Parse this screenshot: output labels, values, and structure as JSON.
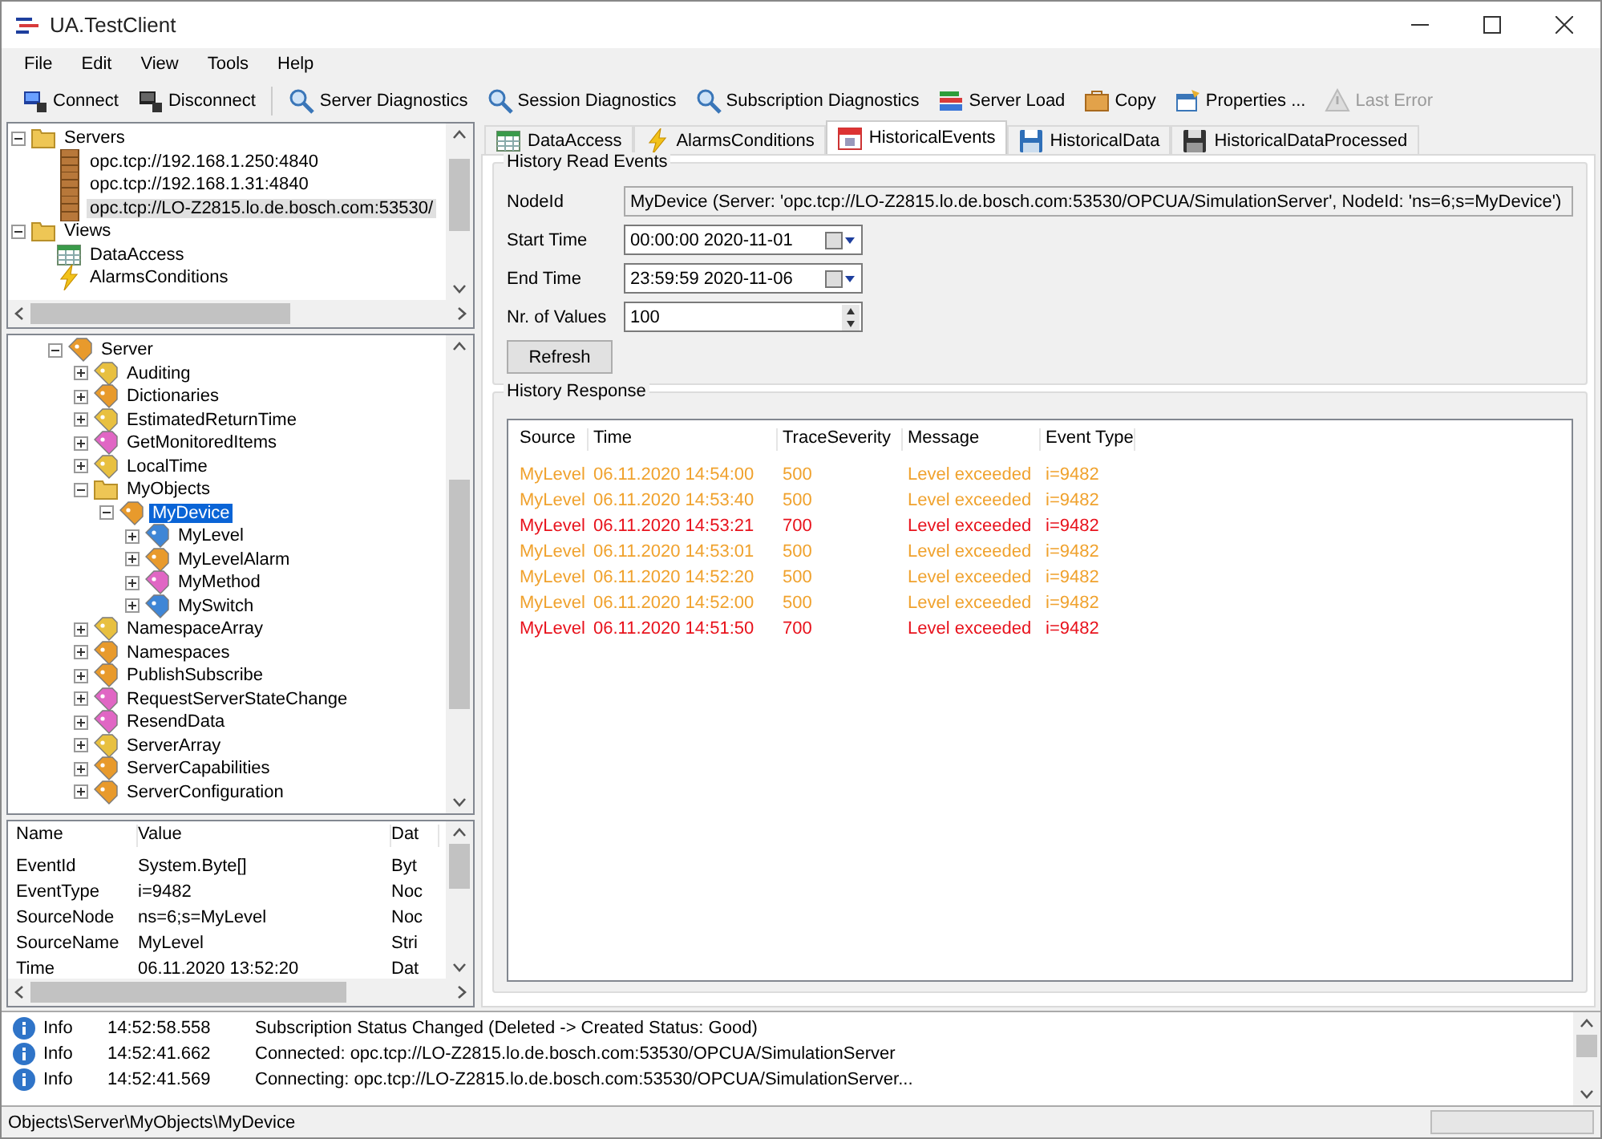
{
  "window": {
    "title": "UA.TestClient"
  },
  "menu": [
    "File",
    "Edit",
    "View",
    "Tools",
    "Help"
  ],
  "toolbar": [
    {
      "label": "Connect",
      "kind": "connect",
      "disabled": false
    },
    {
      "label": "Disconnect",
      "kind": "disconnect",
      "disabled": false,
      "separator_after": true
    },
    {
      "label": "Server Diagnostics",
      "kind": "search",
      "disabled": false
    },
    {
      "label": "Session Diagnostics",
      "kind": "search",
      "disabled": false
    },
    {
      "label": "Subscription Diagnostics",
      "kind": "search",
      "disabled": false
    },
    {
      "label": "Server Load",
      "kind": "load",
      "disabled": false
    },
    {
      "label": "Copy",
      "kind": "copy",
      "disabled": false
    },
    {
      "label": "Properties ...",
      "kind": "properties",
      "disabled": false
    },
    {
      "label": "Last Error",
      "kind": "warning",
      "disabled": true
    }
  ],
  "server_tree": [
    {
      "label": "Servers",
      "kind": "folder",
      "expanded": true,
      "selected": false,
      "children": [
        {
          "label": "opc.tcp://192.168.1.250:4840",
          "kind": "server",
          "selected": false
        },
        {
          "label": "opc.tcp://192.168.1.31:4840",
          "kind": "server",
          "selected": false
        },
        {
          "label": "opc.tcp://LO-Z2815.lo.de.bosch.com:53530/",
          "kind": "server",
          "selected": true
        }
      ]
    },
    {
      "label": "Views",
      "kind": "folder",
      "expanded": true,
      "selected": false,
      "children": [
        {
          "label": "DataAccess",
          "kind": "grid",
          "selected": false
        },
        {
          "label": "AlarmsConditions",
          "kind": "lightning",
          "selected": false
        }
      ]
    }
  ],
  "node_tree": [
    {
      "label": "Server",
      "kind": "object",
      "expanded": true,
      "selected": false,
      "children": [
        {
          "label": "Auditing",
          "kind": "property",
          "expanded": false,
          "selected": false
        },
        {
          "label": "Dictionaries",
          "kind": "object",
          "expanded": false,
          "selected": false
        },
        {
          "label": "EstimatedReturnTime",
          "kind": "property",
          "expanded": false,
          "selected": false
        },
        {
          "label": "GetMonitoredItems",
          "kind": "method",
          "expanded": false,
          "selected": false
        },
        {
          "label": "LocalTime",
          "kind": "property",
          "expanded": false,
          "selected": false
        },
        {
          "label": "MyObjects",
          "kind": "folder",
          "expanded": true,
          "selected": false,
          "children": [
            {
              "label": "MyDevice",
              "kind": "object",
              "expanded": true,
              "selected": true,
              "children": [
                {
                  "label": "MyLevel",
                  "kind": "variable",
                  "expanded": false,
                  "selected": false
                },
                {
                  "label": "MyLevelAlarm",
                  "kind": "object",
                  "expanded": false,
                  "selected": false
                },
                {
                  "label": "MyMethod",
                  "kind": "method",
                  "expanded": false,
                  "selected": false
                },
                {
                  "label": "MySwitch",
                  "kind": "variable",
                  "expanded": false,
                  "selected": false
                }
              ]
            }
          ]
        },
        {
          "label": "NamespaceArray",
          "kind": "property",
          "expanded": false,
          "selected": false
        },
        {
          "label": "Namespaces",
          "kind": "object",
          "expanded": false,
          "selected": false
        },
        {
          "label": "PublishSubscribe",
          "kind": "object",
          "expanded": false,
          "selected": false
        },
        {
          "label": "RequestServerStateChange",
          "kind": "method",
          "expanded": false,
          "selected": false
        },
        {
          "label": "ResendData",
          "kind": "method",
          "expanded": false,
          "selected": false
        },
        {
          "label": "ServerArray",
          "kind": "property",
          "expanded": false,
          "selected": false
        },
        {
          "label": "ServerCapabilities",
          "kind": "object",
          "expanded": false,
          "selected": false
        },
        {
          "label": "ServerConfiguration",
          "kind": "object",
          "expanded": false,
          "selected": false
        }
      ]
    }
  ],
  "attributes": {
    "columns": [
      "Name",
      "Value",
      "Dat"
    ],
    "rows": [
      [
        "EventId",
        "System.Byte[]",
        "Byt"
      ],
      [
        "EventType",
        "i=9482",
        "Noc"
      ],
      [
        "SourceNode",
        "ns=6;s=MyLevel",
        "Noc"
      ],
      [
        "SourceName",
        "MyLevel",
        "Stri"
      ],
      [
        "Time",
        "06.11.2020 13:52:20",
        "Dat"
      ]
    ]
  },
  "tabs": [
    {
      "label": "DataAccess",
      "kind": "grid",
      "selected": false
    },
    {
      "label": "AlarmsConditions",
      "kind": "lightning",
      "selected": false
    },
    {
      "label": "HistoricalEvents",
      "kind": "calendar",
      "selected": true
    },
    {
      "label": "HistoricalData",
      "kind": "disk",
      "selected": false
    },
    {
      "label": "HistoricalDataProcessed",
      "kind": "disk_dark",
      "selected": false
    }
  ],
  "read_events": {
    "title": "History Read Events",
    "node_id": {
      "label": "NodeId",
      "value": "MyDevice (Server: 'opc.tcp://LO-Z2815.lo.de.bosch.com:53530/OPCUA/SimulationServer', NodeId: 'ns=6;s=MyDevice')"
    },
    "start_time": {
      "label": "Start Time",
      "value": "00:00:00 2020-11-01"
    },
    "end_time": {
      "label": "End Time",
      "value": "23:59:59 2020-11-06"
    },
    "num_values": {
      "label": "Nr. of Values",
      "value": "100"
    },
    "refresh_button": "Refresh"
  },
  "response": {
    "title": "History Response",
    "columns": [
      "Source",
      "Time",
      "TraceSeverity",
      "Message",
      "Event Type"
    ],
    "rows": [
      {
        "cells": [
          "MyLevel",
          "06.11.2020 14:54:00",
          "500",
          "Level exceeded",
          "i=9482"
        ],
        "color": "#f0a22e"
      },
      {
        "cells": [
          "MyLevel",
          "06.11.2020 14:53:40",
          "500",
          "Level exceeded",
          "i=9482"
        ],
        "color": "#f0a22e"
      },
      {
        "cells": [
          "MyLevel",
          "06.11.2020 14:53:21",
          "700",
          "Level exceeded",
          "i=9482"
        ],
        "color": "#e8121c"
      },
      {
        "cells": [
          "MyLevel",
          "06.11.2020 14:53:01",
          "500",
          "Level exceeded",
          "i=9482"
        ],
        "color": "#f0a22e"
      },
      {
        "cells": [
          "MyLevel",
          "06.11.2020 14:52:20",
          "500",
          "Level exceeded",
          "i=9482"
        ],
        "color": "#f0a22e"
      },
      {
        "cells": [
          "MyLevel",
          "06.11.2020 14:52:00",
          "500",
          "Level exceeded",
          "i=9482"
        ],
        "color": "#f0a22e"
      },
      {
        "cells": [
          "MyLevel",
          "06.11.2020 14:51:50",
          "700",
          "Level exceeded",
          "i=9482"
        ],
        "color": "#e8121c"
      }
    ]
  },
  "log": [
    {
      "level": "Info",
      "time": "14:52:58.558",
      "message": "Subscription Status Changed (Deleted -> Created Status: Good)"
    },
    {
      "level": "Info",
      "time": "14:52:41.662",
      "message": "Connected: opc.tcp://LO-Z2815.lo.de.bosch.com:53530/OPCUA/SimulationServer"
    },
    {
      "level": "Info",
      "time": "14:52:41.569",
      "message": "Connecting: opc.tcp://LO-Z2815.lo.de.bosch.com:53530/OPCUA/SimulationServer..."
    }
  ],
  "status_bar": {
    "path": "Objects\\Server\\MyObjects\\MyDevice"
  }
}
